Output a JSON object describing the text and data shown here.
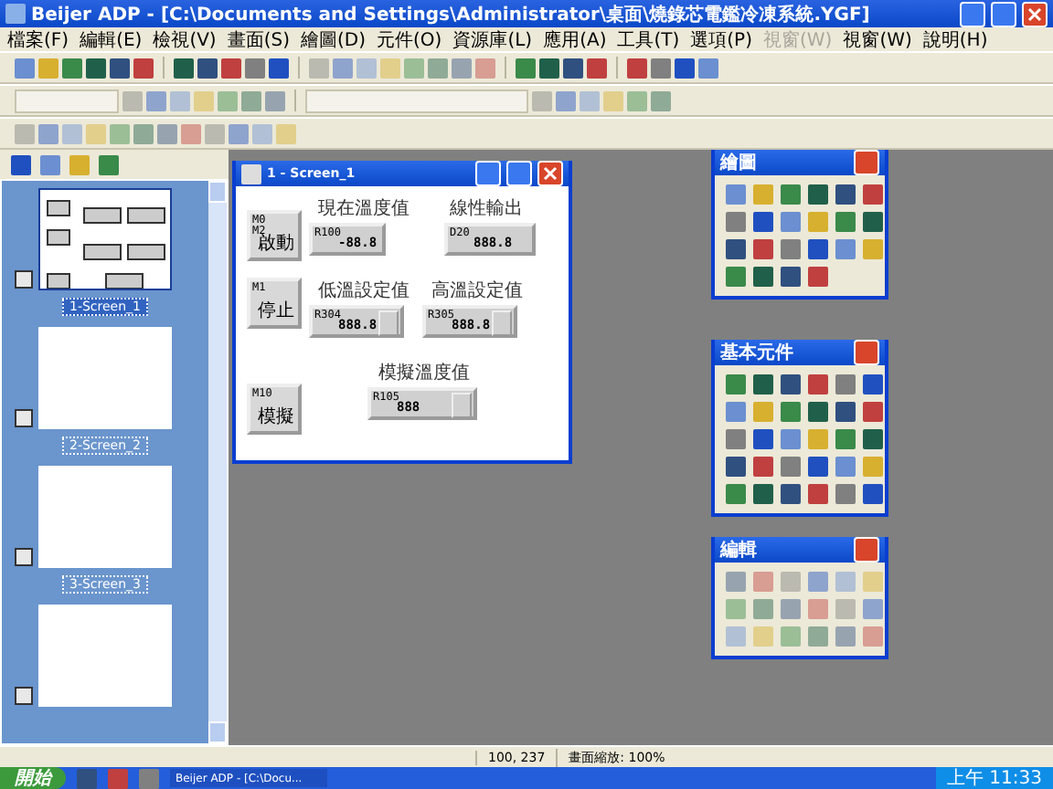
{
  "window": {
    "title": "Beijer ADP - [C:\\Documents and Settings\\Administrator\\桌面\\燒錄芯電鑑冷凍系統.YGF]"
  },
  "menu": [
    {
      "label": "檔案(F)",
      "disabled": false
    },
    {
      "label": "編輯(E)",
      "disabled": false
    },
    {
      "label": "檢視(V)",
      "disabled": false
    },
    {
      "label": "畫面(S)",
      "disabled": false
    },
    {
      "label": "繪圖(D)",
      "disabled": false
    },
    {
      "label": "元件(O)",
      "disabled": false
    },
    {
      "label": "資源庫(L)",
      "disabled": false
    },
    {
      "label": "應用(A)",
      "disabled": false
    },
    {
      "label": "工具(T)",
      "disabled": false
    },
    {
      "label": "選項(P)",
      "disabled": false
    },
    {
      "label": "視窗(W)",
      "disabled": true
    },
    {
      "label": "視窗(W)",
      "disabled": false
    },
    {
      "label": "說明(H)",
      "disabled": false
    }
  ],
  "screen_list": [
    {
      "label": "1-Screen_1",
      "selected": true,
      "has_content": true
    },
    {
      "label": "2-Screen_2",
      "selected": false,
      "has_content": false
    },
    {
      "label": "3-Screen_3",
      "selected": false,
      "has_content": false
    },
    {
      "selected": false,
      "has_content": false
    }
  ],
  "screen_window": {
    "title": "1 - Screen_1",
    "buttons": [
      {
        "tag": "M0\nM2",
        "label": "啟動"
      },
      {
        "tag": "M1",
        "label": "停止"
      },
      {
        "tag": "M10",
        "label": "模擬"
      }
    ],
    "displays": [
      {
        "label": "現在溫度值",
        "tag": "R100",
        "value": "-88.8",
        "kind": "display"
      },
      {
        "label": "線性輸出",
        "tag": "D20",
        "value": "888.8",
        "kind": "display"
      },
      {
        "label": "低溫設定值",
        "tag": "R304",
        "value": "888.8",
        "kind": "input"
      },
      {
        "label": "高溫設定值",
        "tag": "R305",
        "value": "888.8",
        "kind": "input"
      },
      {
        "label": "模擬溫度值",
        "tag": "R105",
        "value": "888",
        "kind": "input"
      }
    ]
  },
  "palettes": [
    {
      "title": "繪圖"
    },
    {
      "title": "基本元件"
    },
    {
      "title": "編輯"
    }
  ],
  "status_bar": {
    "position": "100, 237",
    "zoom": "畫面縮放: 100%"
  },
  "taskbar": {
    "start": "開始",
    "task": "Beijer ADP - [C:\\Docu...",
    "clock": "上午 11:33"
  }
}
